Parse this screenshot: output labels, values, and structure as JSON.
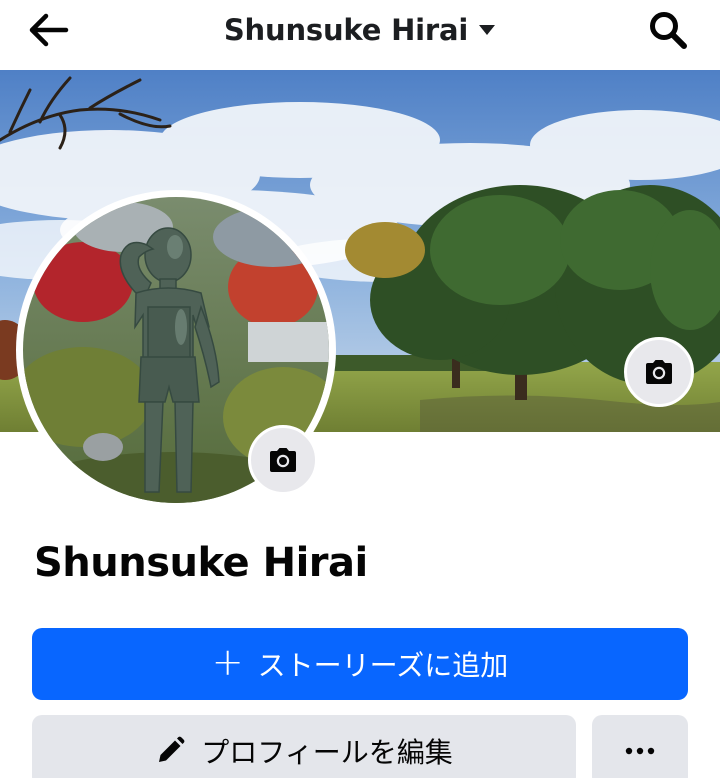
{
  "header": {
    "title": "Shunsuke Hirai",
    "back_icon": "arrow-left-icon",
    "dropdown_icon": "caret-down-icon",
    "search_icon": "search-icon"
  },
  "profile": {
    "name": "Shunsuke Hirai",
    "cover_photo": "cover-photo",
    "profile_photo": "profile-photo",
    "camera_icon": "camera-icon"
  },
  "actions": {
    "add_story_label": "ストーリーズに追加",
    "edit_profile_label": "プロフィールを編集",
    "more_icon": "more-horizontal-icon"
  },
  "colors": {
    "primary": "#0866ff",
    "secondary_bg": "#e4e6eb",
    "text": "#050505"
  }
}
